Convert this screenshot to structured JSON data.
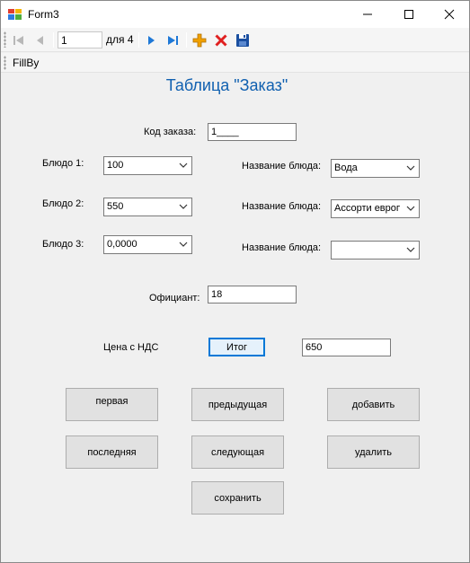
{
  "window": {
    "title": "Form3"
  },
  "navigator": {
    "position": "1",
    "of_label": "для 4"
  },
  "menu": {
    "fillby": "FillBy"
  },
  "heading": "Таблица \"Заказ\"",
  "form": {
    "order_code_label": "Код заказа:",
    "order_code_value": "1____",
    "dish1_label": "Блюдо 1:",
    "dish1_value": "100",
    "dish2_label": "Блюдо 2:",
    "dish2_value": "550",
    "dish3_label": "Блюдо 3:",
    "dish3_value": "0,0000",
    "dishname1_label": "Название блюда:",
    "dishname1_value": "Вода",
    "dishname2_label": "Название блюда:",
    "dishname2_value": "Ассорти европе",
    "dishname3_label": "Название блюда:",
    "dishname3_value": "",
    "waiter_label": "Официант:",
    "waiter_value": "18",
    "price_label": "Цена с НДС",
    "total_button": "Итог",
    "total_value": "650"
  },
  "buttons": {
    "first": "первая",
    "previous": "предыдущая",
    "add": "добавить",
    "last": "последняя",
    "next": "следующая",
    "delete": "удалить",
    "save": "сохранить"
  },
  "colors": {
    "heading": "#1060b0",
    "nav_blue": "#1e78d7",
    "add_orange": "#f0a000",
    "delete_red": "#e02020",
    "save_blue": "#1a4fa0",
    "focus_border": "#0078d7"
  }
}
